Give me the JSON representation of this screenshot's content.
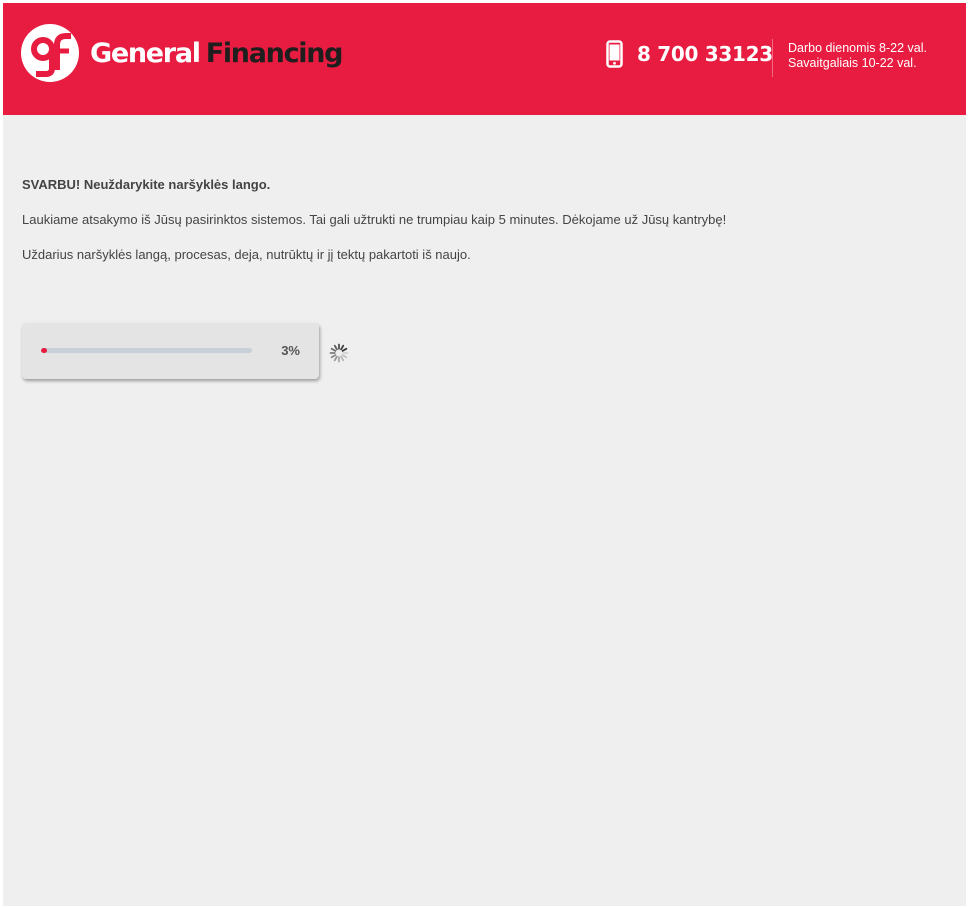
{
  "header": {
    "logo_mark": "gf",
    "brand_word1": "General",
    "brand_word2": "Financing",
    "phone_icon": "mobile-phone-icon",
    "phone_number": "8 700 33123",
    "hours_line1": "Darbo dienomis 8-22 val.",
    "hours_line2": "Savaitgaliais 10-22 val."
  },
  "main": {
    "important": "SVARBU! Neuždarykite naršyklės lango.",
    "waiting_text": "Laukiame atsakymo iš Jūsų pasirinktos sistemos. Tai gali užtrukti ne trumpiau kaip 5 minutes. Dėkojame už Jūsų kantrybę!",
    "warning_text": "Uždarius naršyklės langą, procesas, deja, nutrūktų ir jį tektų pakartoti iš naujo."
  },
  "progress": {
    "value": 0.03,
    "label": "3%",
    "spinner_icon": "loading-spinner-icon"
  },
  "colors": {
    "brand": "#e81c40",
    "background": "#efefef",
    "text": "#444444"
  }
}
